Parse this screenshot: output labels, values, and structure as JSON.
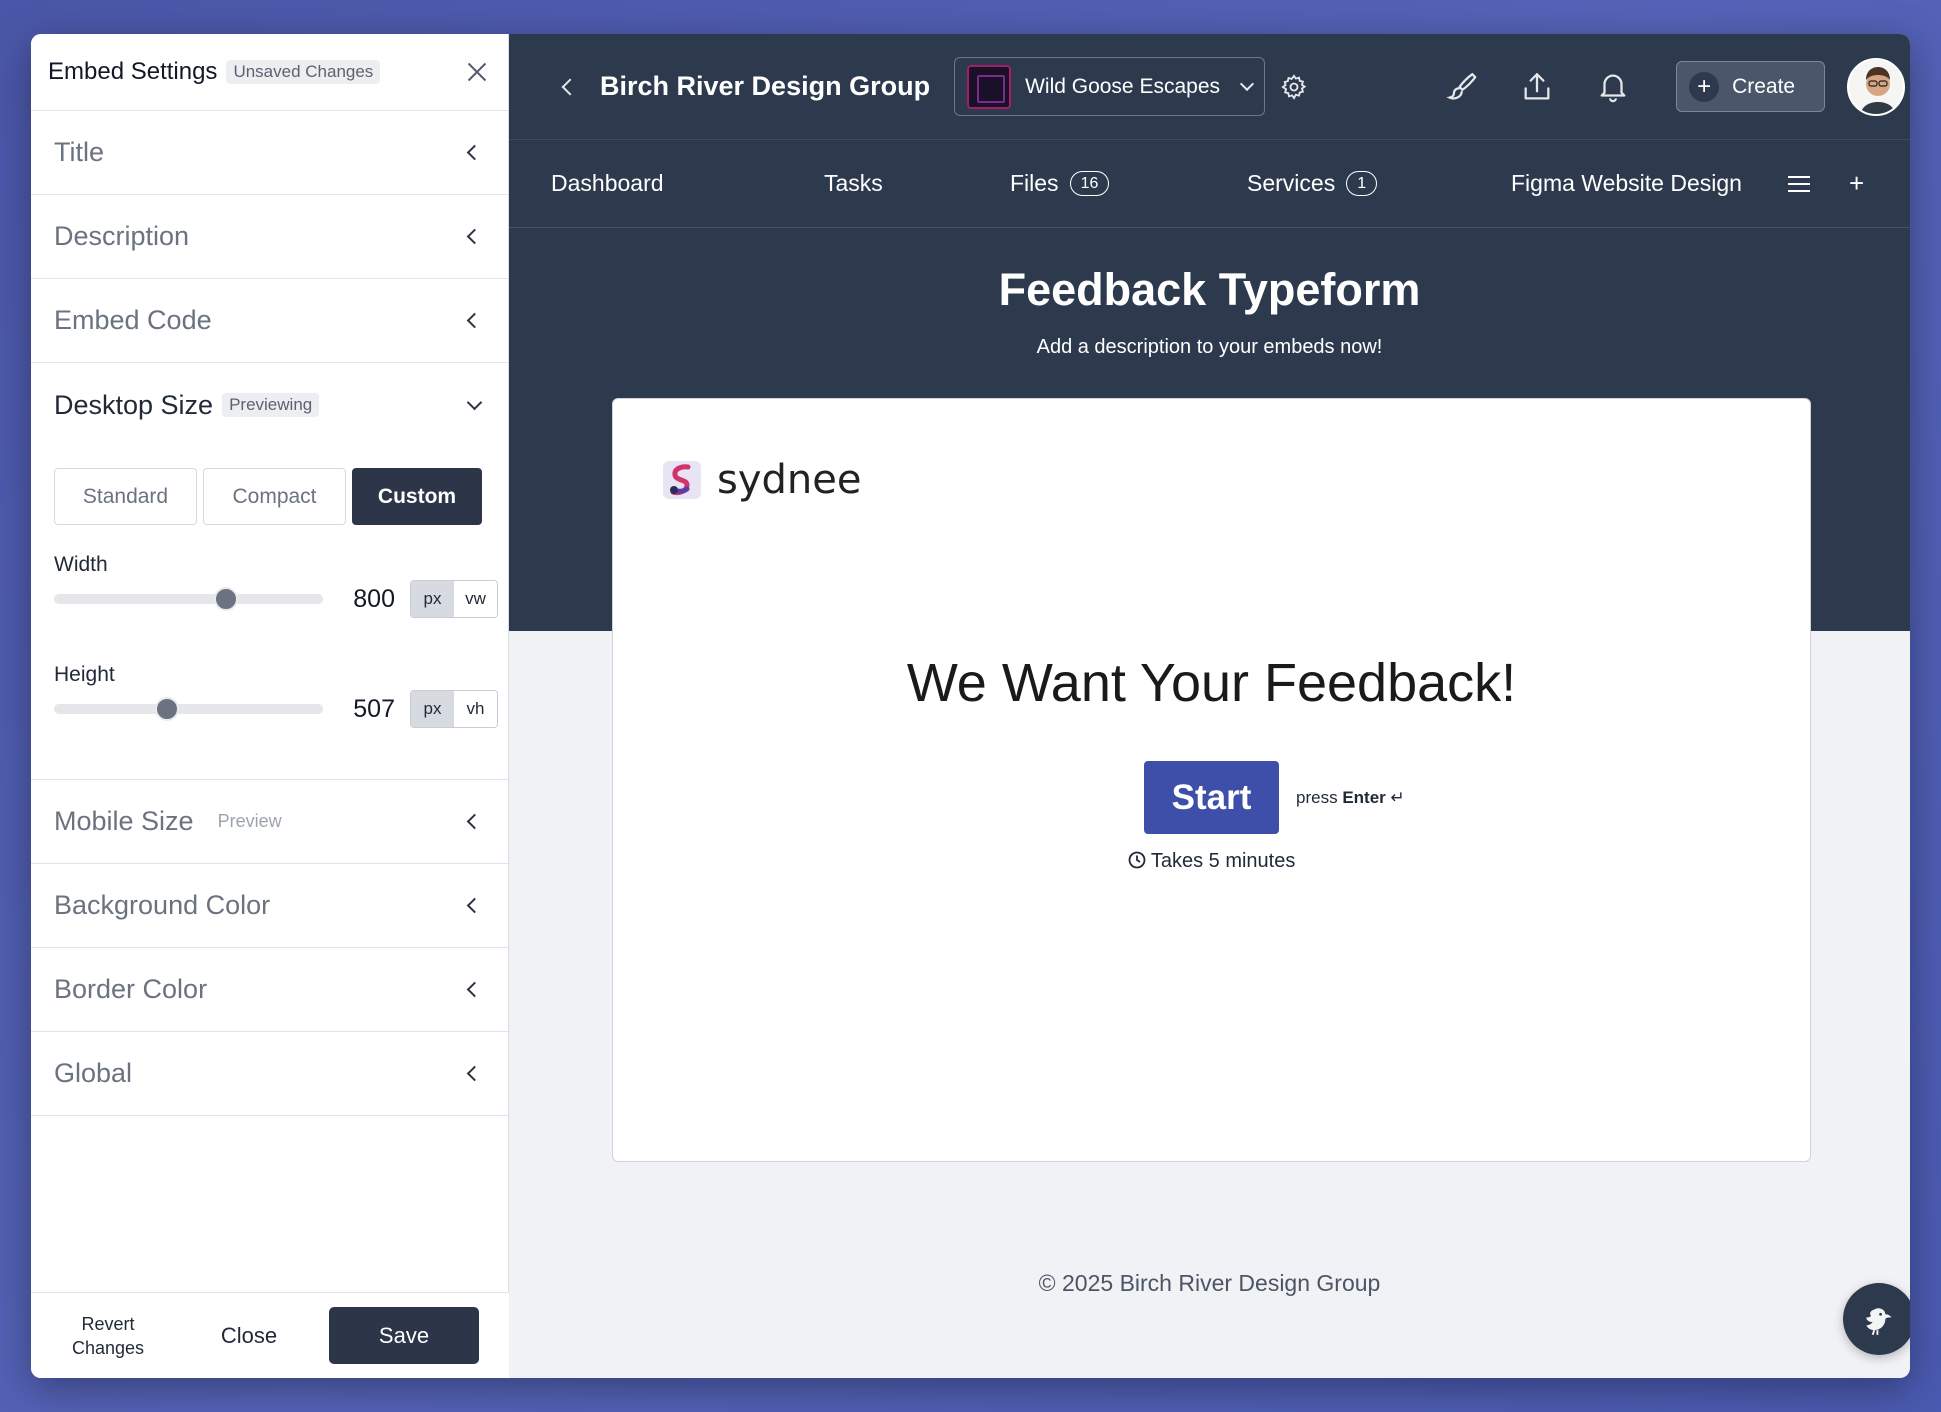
{
  "sidebar": {
    "title": "Embed Settings",
    "status_pill": "Unsaved Changes",
    "sections": {
      "title": "Title",
      "description": "Description",
      "embed_code": "Embed Code",
      "desktop_size": "Desktop Size",
      "desktop_pill": "Previewing",
      "mobile_size": "Mobile Size",
      "mobile_pill": "Preview",
      "background_color": "Background Color",
      "border_color": "Border Color",
      "global": "Global"
    },
    "size_presets": [
      "Standard",
      "Compact",
      "Custom"
    ],
    "selected_preset": "Custom",
    "width": {
      "label": "Width",
      "value": "800",
      "slider_fraction": 0.64,
      "units": [
        "px",
        "vw"
      ],
      "selected_unit": "px"
    },
    "height": {
      "label": "Height",
      "value": "507",
      "slider_fraction": 0.42,
      "units": [
        "px",
        "vh"
      ],
      "selected_unit": "px"
    },
    "footer": {
      "revert_line1": "Revert",
      "revert_line2": "Changes",
      "close": "Close",
      "save": "Save"
    }
  },
  "topbar": {
    "org_name": "Birch River Design Group",
    "project_name": "Wild Goose Escapes",
    "create_label": "Create",
    "icons": [
      "chevron-left-icon",
      "settings-gear-icon",
      "brush-icon",
      "share-upload-icon",
      "bell-icon",
      "plus-icon"
    ]
  },
  "tabs": {
    "dashboard": "Dashboard",
    "tasks": "Tasks",
    "files": "Files",
    "files_count": "16",
    "services": "Services",
    "services_count": "1",
    "figma": "Figma Website Design",
    "add": "+"
  },
  "embed": {
    "title": "Feedback Typeform",
    "description": "Add a description to your embeds now!",
    "brand": "sydnee",
    "heading": "We Want Your Feedback!",
    "start_label": "Start",
    "press_prefix": "press",
    "press_key": "Enter",
    "press_symbol": "↵",
    "takes": "Takes 5 minutes"
  },
  "footer": {
    "copyright": "© 2025 Birch River Design Group"
  },
  "colors": {
    "nav_bg": "#2d3a4e",
    "accent_button": "#3d4fa8",
    "page_bg": "#4a57a8",
    "active_dark": "#2d3648"
  }
}
